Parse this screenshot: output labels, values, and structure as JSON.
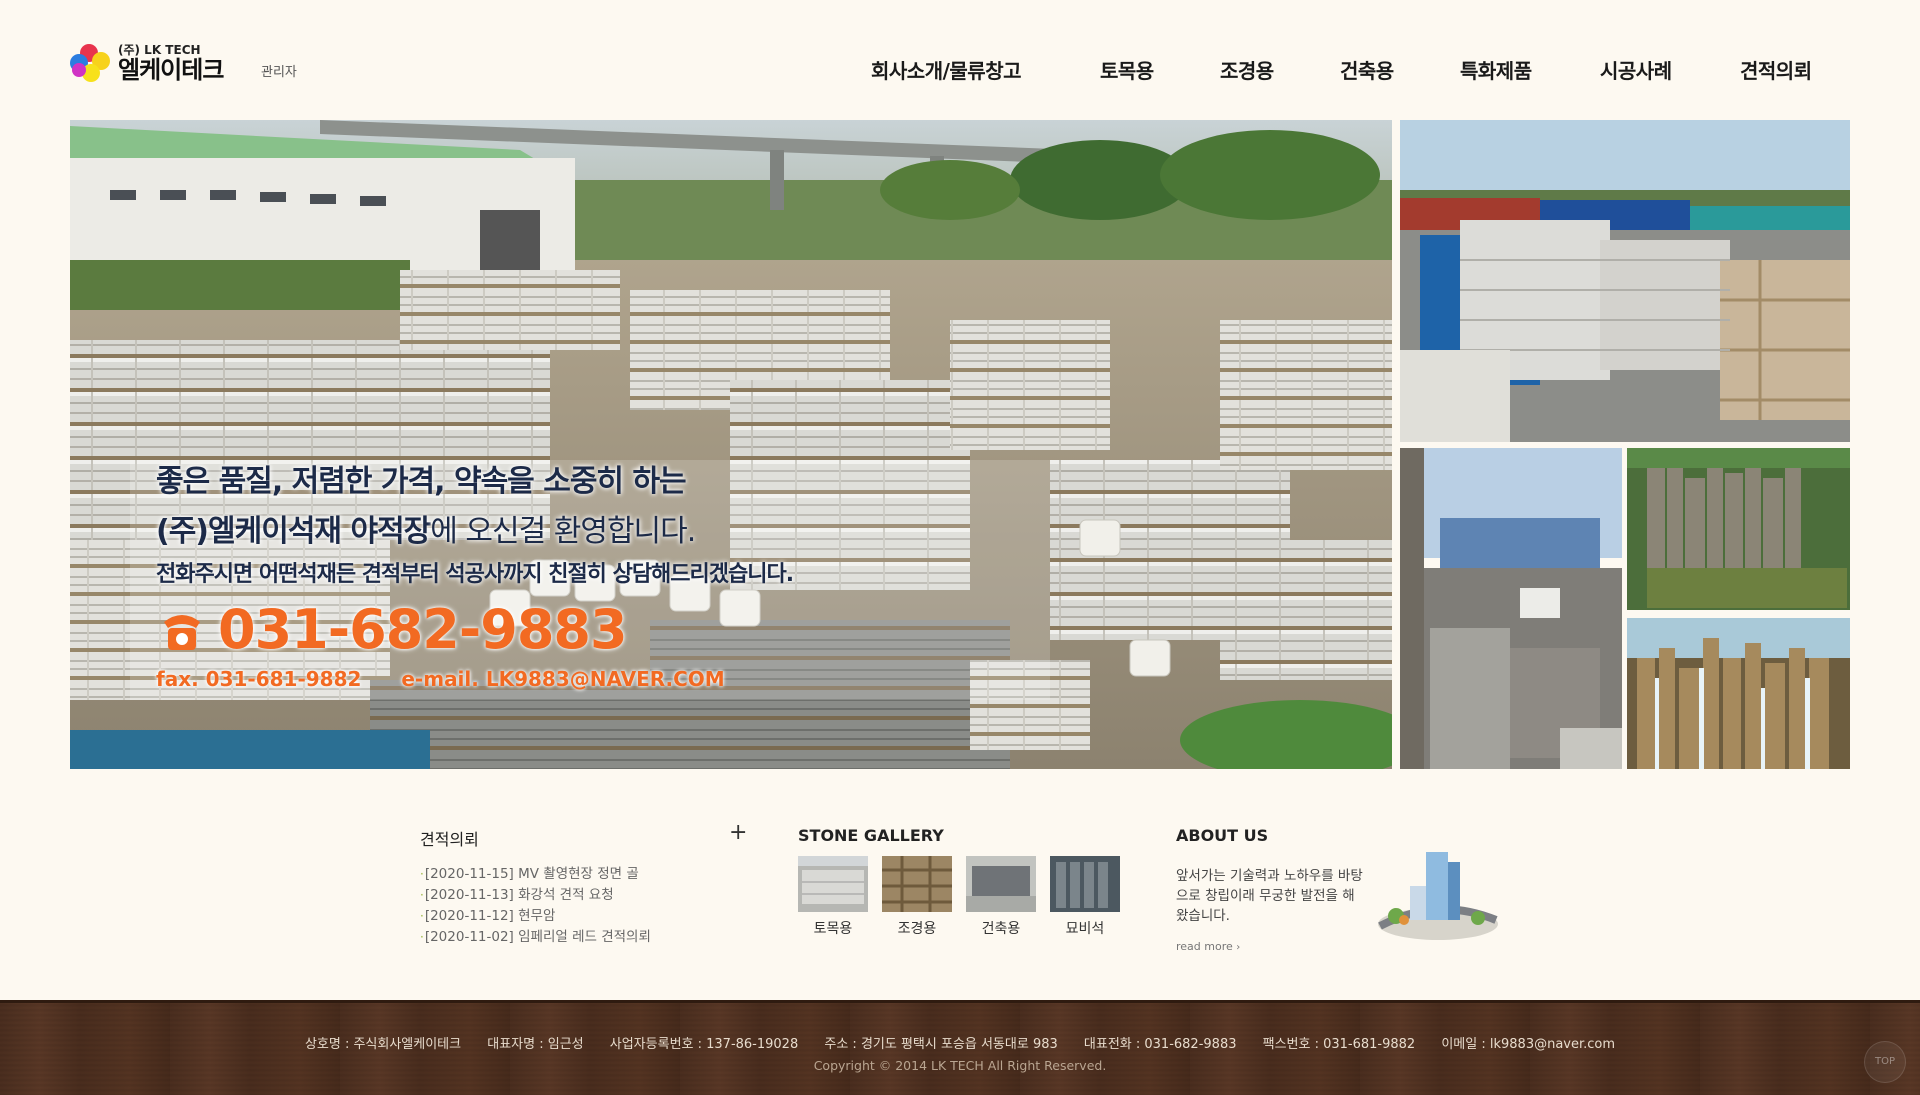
{
  "header": {
    "logo_sub": "(주) LK TECH",
    "logo_main": "엘케이테크",
    "admin_link": "관리자",
    "nav": [
      "회사소개/물류창고",
      "토목용",
      "조경용",
      "건축용",
      "특화제품",
      "시공사례",
      "견적의뢰"
    ]
  },
  "hero": {
    "line1": "좋은 품질, 저렴한 가격, 약속을 소중히 하는",
    "line2_company": "(주)엘케이석재 야적장",
    "line2_rest": "에 오신걸 환영합니다.",
    "line3": "전화주시면 어떤석재든 견적부터 석공사까지 친절히 상담해드리겠습니다.",
    "phone_icon": "phone-icon",
    "phone": "031-682-9883",
    "fax": "fax. 031-681-9882",
    "email": "e-mail. LK9883@NAVER.COM"
  },
  "quotes": {
    "title": "견적의뢰",
    "more_icon": "plus-icon",
    "items": [
      "[2020-11-15] MV 촬영현장 정면 골",
      "[2020-11-13] 화강석 견적 요청",
      "[2020-11-12] 현무암",
      "[2020-11-02] 임페리얼 레드 견적의뢰"
    ]
  },
  "gallery": {
    "title": "STONE GALLERY",
    "items": [
      "토목용",
      "조경용",
      "건축용",
      "묘비석"
    ]
  },
  "about": {
    "title": "ABOUT US",
    "text": "앞서가는 기술력과 노하우를 바탕으로 창립이래 무궁한 발전을 해왔습니다.",
    "read_more": "read more",
    "read_more_icon": "chevron-right-icon"
  },
  "footer": {
    "company": "상호명 : 주식회사엘케이테크",
    "ceo": "대표자명 : 임근성",
    "business_no": "사업자등록번호 : 137-86-19028",
    "address": "주소 : 경기도 평택시 포승읍 서동대로 983",
    "tel": "대표전화 : 031-682-9883",
    "fax": "팩스번호 : 031-681-9882",
    "email": "이메일 : lk9883@naver.com",
    "copyright": "Copyright © 2014 LK TECH All Right Reserved.",
    "top_button": "TOP"
  },
  "colors": {
    "background": "#fdf9f1",
    "accent_orange": "#f26a22",
    "hero_text_dark": "#1c2a48",
    "footer_wood": "#4e3020"
  }
}
